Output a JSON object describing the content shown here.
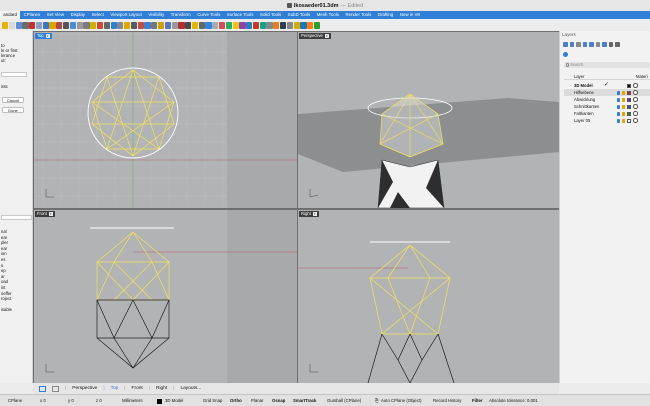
{
  "titlebar": {
    "doc": "Ikosaeder01.3dm",
    "state": "— Edited"
  },
  "tabs": [
    "andard",
    "CPlanes",
    "Set View",
    "Display",
    "Select",
    "Viewport Layout",
    "Visibility",
    "Transform",
    "Curve Tools",
    "Surface Tools",
    "Solid Tools",
    "SubD Tools",
    "Mesh Tools",
    "Render Tools",
    "Drafting",
    "New in V8"
  ],
  "left_panel": {
    "prompt_lines": [
      "to",
      "le or first",
      "lerance",
      "ut:"
    ],
    "points_label": "ints",
    "cancel_label": "Cancel",
    "done_label": "Done",
    "list_items": [
      "nal",
      "ear",
      "pler",
      "ear",
      "ion",
      "es",
      "s",
      "ep",
      "ar",
      "oad",
      "int",
      "oeffer",
      "roject",
      "",
      "isable"
    ]
  },
  "viewports": {
    "top": "Top",
    "perspective": "Perspective",
    "front": "Front",
    "right": "Right"
  },
  "layers": {
    "header": "Layers",
    "search_placeholder": "Search",
    "col_layer": "Layer",
    "col_material": "Materi",
    "rows": [
      {
        "name": "3D Model",
        "bold": true,
        "current": true
      },
      {
        "name": "Hilfsebene",
        "color": "#d22"
      },
      {
        "name": "Abwicklung",
        "color": "#6b2fb3"
      },
      {
        "name": "Schnittkanten",
        "color": "#2f4fd6"
      },
      {
        "name": "Faltkanten",
        "color": "#2e8b2e"
      },
      {
        "name": "Layer 05",
        "color": "#ffffff"
      }
    ]
  },
  "viewport_tabs": [
    "Perspective",
    "Top",
    "Front",
    "Right",
    "Layouts..."
  ],
  "statusbar": {
    "cplane": "CPlane",
    "x": "x 0",
    "y": "y 0",
    "z": "z 0",
    "units": "Millimeters",
    "layer": "3D Model",
    "grid_snap": "Grid Snap",
    "ortho": "Ortho",
    "planar": "Planar",
    "osnap": "Osnap",
    "smarttrack": "SmartTrack",
    "gumball": "Gumball (CPlane)",
    "autocplane": "Auto CPlane (Object)",
    "record_history": "Record History",
    "filter": "Filter",
    "tolerance": "Absolute tolerance: 0.001"
  },
  "colors": {
    "accent": "#2f7fd6",
    "viewport_bg": "#b2b3b5",
    "wire_yellow": "#f2e35a"
  }
}
